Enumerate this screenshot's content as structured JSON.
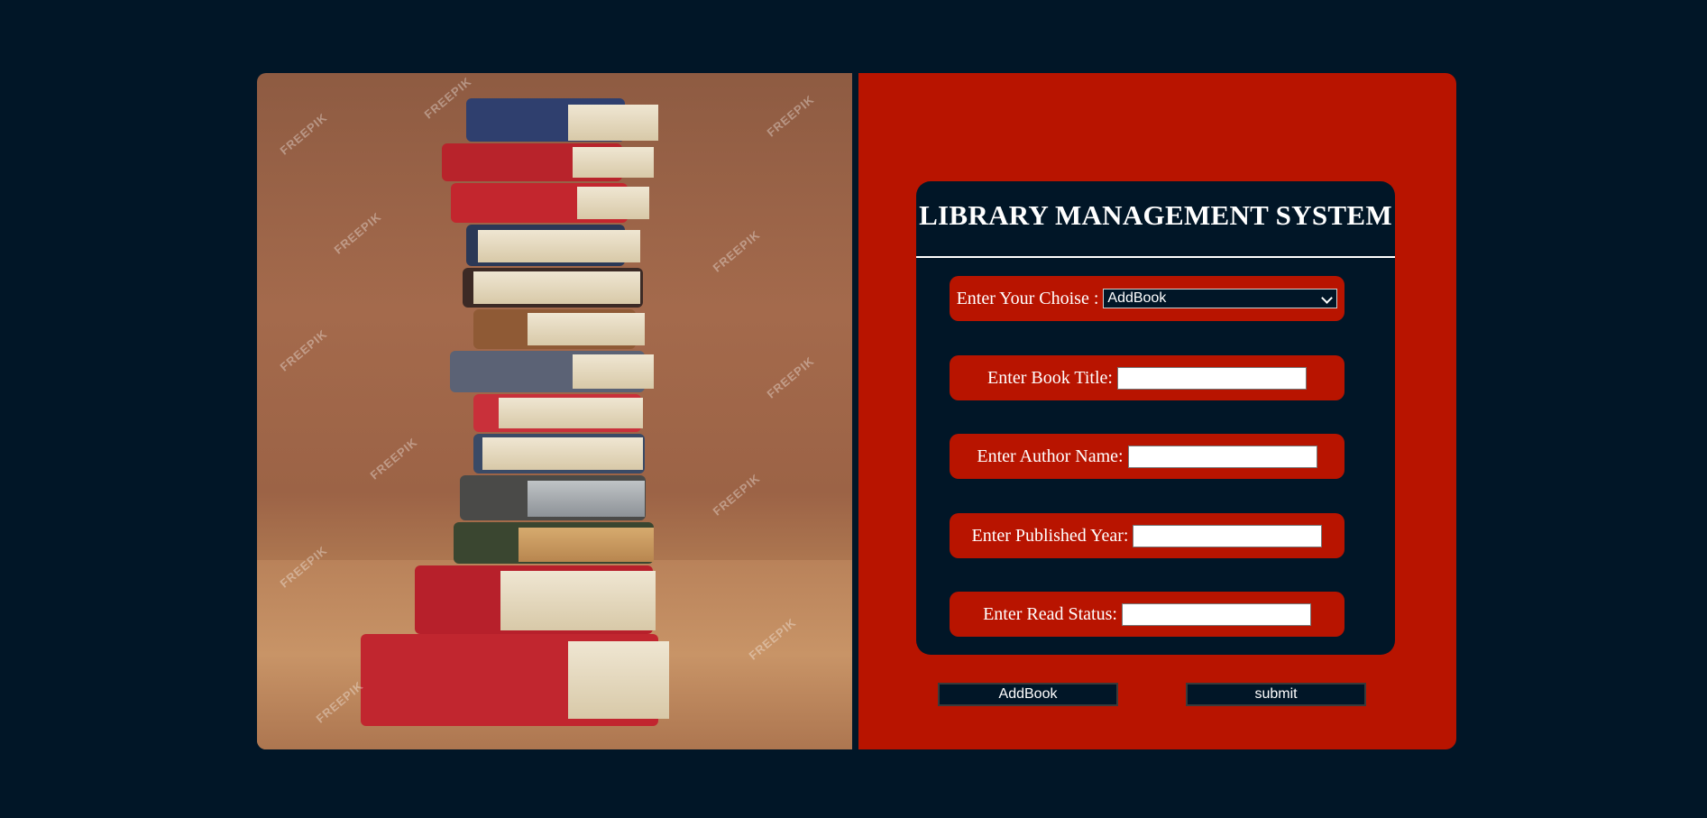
{
  "form": {
    "title": "LIBRARY MANAGEMENT SYSTEM",
    "choice_label": "Enter Your Choise :",
    "choice_selected": "AddBook",
    "book_title_label": "Enter Book Title:",
    "author_label": "Enter Author Name:",
    "year_label": "Enter Published Year:",
    "status_label": "Enter Read Status:",
    "book_title_value": "",
    "author_value": "",
    "year_value": "",
    "status_value": ""
  },
  "buttons": {
    "action_label": "AddBook",
    "submit_label": "submit"
  },
  "image": {
    "watermark_text": "FREEPIK"
  },
  "colors": {
    "background": "#011627",
    "panel_red": "#b81400",
    "card_navy": "#011627",
    "text": "#ffffff"
  }
}
